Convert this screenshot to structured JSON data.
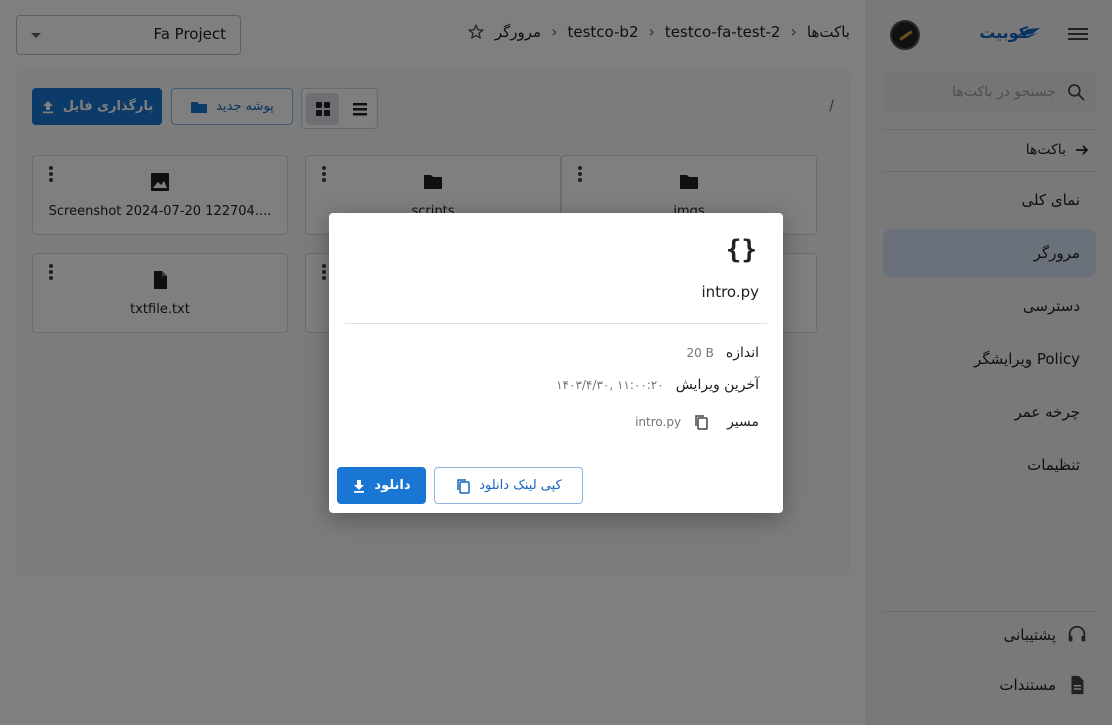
{
  "sidebar": {
    "logo_text": "کوبیت",
    "search_placeholder": "جستجو در باکت‌ها",
    "back_label": "باکت‌ها",
    "items": [
      {
        "label": "نمای کلی"
      },
      {
        "label": "مرورگر"
      },
      {
        "label": "دسترسی"
      },
      {
        "label": "ویرایشگر Policy"
      },
      {
        "label": "چرخه عمر"
      },
      {
        "label": "تنظیمات"
      }
    ],
    "active_item": "مرورگر",
    "bottom": {
      "support_label": "پشتیبانی",
      "docs_label": "مستندات"
    }
  },
  "topbar": {
    "project": "Fa Project",
    "breadcrumb": [
      "باکت‌ها",
      "testco-fa-test-2",
      "testco-b2",
      "مرورگر"
    ]
  },
  "toolbar": {
    "upload_label": "بارگذاری فایل",
    "new_folder_label": "پوشه جدید",
    "path": "/"
  },
  "files": [
    {
      "name": "imgs",
      "type": "folder"
    },
    {
      "name": "scripts",
      "type": "folder"
    },
    {
      "name": "Screenshot 2024-07-20 122704....",
      "type": "image"
    },
    {
      "name": "txtfile.txt",
      "type": "text"
    }
  ],
  "dialog": {
    "icon": "{}",
    "title": "intro.py",
    "size_label": "اندازه",
    "size_value": "20 B",
    "modified_label": "آخرین ویرایش",
    "modified_value": "۱۴۰۳/۴/۳۰, ۱۱:۰۰:۲۰",
    "path_label": "مسیر",
    "path_value": "intro.py",
    "download_label": "دانلود",
    "copy_link_label": "کپی لینک دانلود"
  },
  "colors": {
    "primary": "#1976d2",
    "active_nav": "#d5e3f7"
  }
}
